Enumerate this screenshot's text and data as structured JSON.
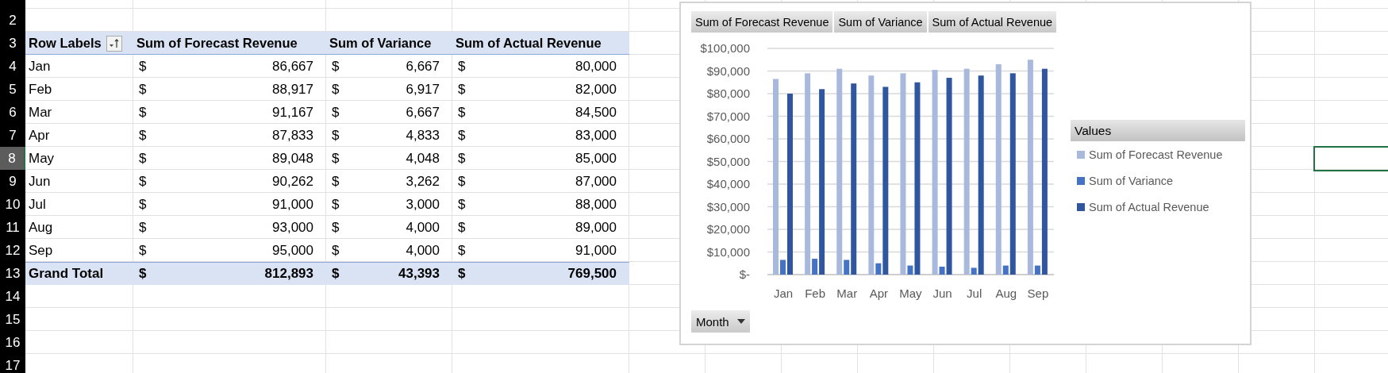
{
  "row_numbers": [
    {
      "label": "2",
      "selected": false
    },
    {
      "label": "3",
      "selected": false
    },
    {
      "label": "4",
      "selected": false
    },
    {
      "label": "5",
      "selected": false
    },
    {
      "label": "6",
      "selected": false
    },
    {
      "label": "7",
      "selected": false
    },
    {
      "label": "8",
      "selected": true
    },
    {
      "label": "9",
      "selected": false
    },
    {
      "label": "10",
      "selected": false
    },
    {
      "label": "11",
      "selected": false
    },
    {
      "label": "12",
      "selected": false
    },
    {
      "label": "13",
      "selected": false
    },
    {
      "label": "14",
      "selected": false
    },
    {
      "label": "15",
      "selected": false
    },
    {
      "label": "16",
      "selected": false
    },
    {
      "label": "17",
      "selected": false
    }
  ],
  "pivot": {
    "headers": [
      "Row Labels",
      "Sum of Forecast Revenue",
      "Sum of Variance",
      "Sum of Actual Revenue"
    ],
    "rows": [
      {
        "label": "Jan",
        "cells": [
          {
            "symbol": "$",
            "value": "86,667"
          },
          {
            "symbol": "$",
            "value": "6,667"
          },
          {
            "symbol": "$",
            "value": "80,000"
          }
        ]
      },
      {
        "label": "Feb",
        "cells": [
          {
            "symbol": "$",
            "value": "88,917"
          },
          {
            "symbol": "$",
            "value": "6,917"
          },
          {
            "symbol": "$",
            "value": "82,000"
          }
        ]
      },
      {
        "label": "Mar",
        "cells": [
          {
            "symbol": "$",
            "value": "91,167"
          },
          {
            "symbol": "$",
            "value": "6,667"
          },
          {
            "symbol": "$",
            "value": "84,500"
          }
        ]
      },
      {
        "label": "Apr",
        "cells": [
          {
            "symbol": "$",
            "value": "87,833"
          },
          {
            "symbol": "$",
            "value": "4,833"
          },
          {
            "symbol": "$",
            "value": "83,000"
          }
        ]
      },
      {
        "label": "May",
        "cells": [
          {
            "symbol": "$",
            "value": "89,048"
          },
          {
            "symbol": "$",
            "value": "4,048"
          },
          {
            "symbol": "$",
            "value": "85,000"
          }
        ]
      },
      {
        "label": "Jun",
        "cells": [
          {
            "symbol": "$",
            "value": "90,262"
          },
          {
            "symbol": "$",
            "value": "3,262"
          },
          {
            "symbol": "$",
            "value": "87,000"
          }
        ]
      },
      {
        "label": "Jul",
        "cells": [
          {
            "symbol": "$",
            "value": "91,000"
          },
          {
            "symbol": "$",
            "value": "3,000"
          },
          {
            "symbol": "$",
            "value": "88,000"
          }
        ]
      },
      {
        "label": "Aug",
        "cells": [
          {
            "symbol": "$",
            "value": "93,000"
          },
          {
            "symbol": "$",
            "value": "4,000"
          },
          {
            "symbol": "$",
            "value": "89,000"
          }
        ]
      },
      {
        "label": "Sep",
        "cells": [
          {
            "symbol": "$",
            "value": "95,000"
          },
          {
            "symbol": "$",
            "value": "4,000"
          },
          {
            "symbol": "$",
            "value": "91,000"
          }
        ]
      }
    ],
    "total": {
      "label": "Grand Total",
      "cells": [
        {
          "symbol": "$",
          "value": "812,893"
        },
        {
          "symbol": "$",
          "value": "43,393"
        },
        {
          "symbol": "$",
          "value": "769,500"
        }
      ]
    }
  },
  "chart": {
    "field_buttons": [
      "Sum of Forecast Revenue",
      "Sum of Variance",
      "Sum of Actual Revenue"
    ],
    "axis_button": "Month",
    "legend_title": "Values",
    "chart_data": {
      "type": "bar",
      "grid": true,
      "categories": [
        "Jan",
        "Feb",
        "Mar",
        "Apr",
        "May",
        "Jun",
        "Jul",
        "Aug",
        "Sep"
      ],
      "series": [
        {
          "name": "Sum of Forecast Revenue",
          "color": "#a9b9de",
          "values": [
            86500,
            89000,
            91000,
            88000,
            89000,
            90500,
            91000,
            93000,
            95000
          ]
        },
        {
          "name": "Sum of Variance",
          "color": "#4472c4",
          "values": [
            6500,
            7000,
            6500,
            5000,
            4000,
            3500,
            3000,
            4000,
            4000
          ]
        },
        {
          "name": "Sum of Actual Revenue",
          "color": "#2f569f",
          "values": [
            80000,
            82000,
            84500,
            83000,
            85000,
            87000,
            88000,
            89000,
            91000
          ]
        }
      ],
      "ylim": [
        0,
        100000
      ],
      "yticks": [
        {
          "value": 0,
          "label": "$-"
        },
        {
          "value": 10000,
          "label": "$10,000"
        },
        {
          "value": 20000,
          "label": "$20,000"
        },
        {
          "value": 30000,
          "label": "$30,000"
        },
        {
          "value": 40000,
          "label": "$40,000"
        },
        {
          "value": 50000,
          "label": "$50,000"
        },
        {
          "value": 60000,
          "label": "$60,000"
        },
        {
          "value": 70000,
          "label": "$70,000"
        },
        {
          "value": 80000,
          "label": "$80,000"
        },
        {
          "value": 90000,
          "label": "$90,000"
        },
        {
          "value": 100000,
          "label": "$100,000"
        }
      ]
    }
  }
}
